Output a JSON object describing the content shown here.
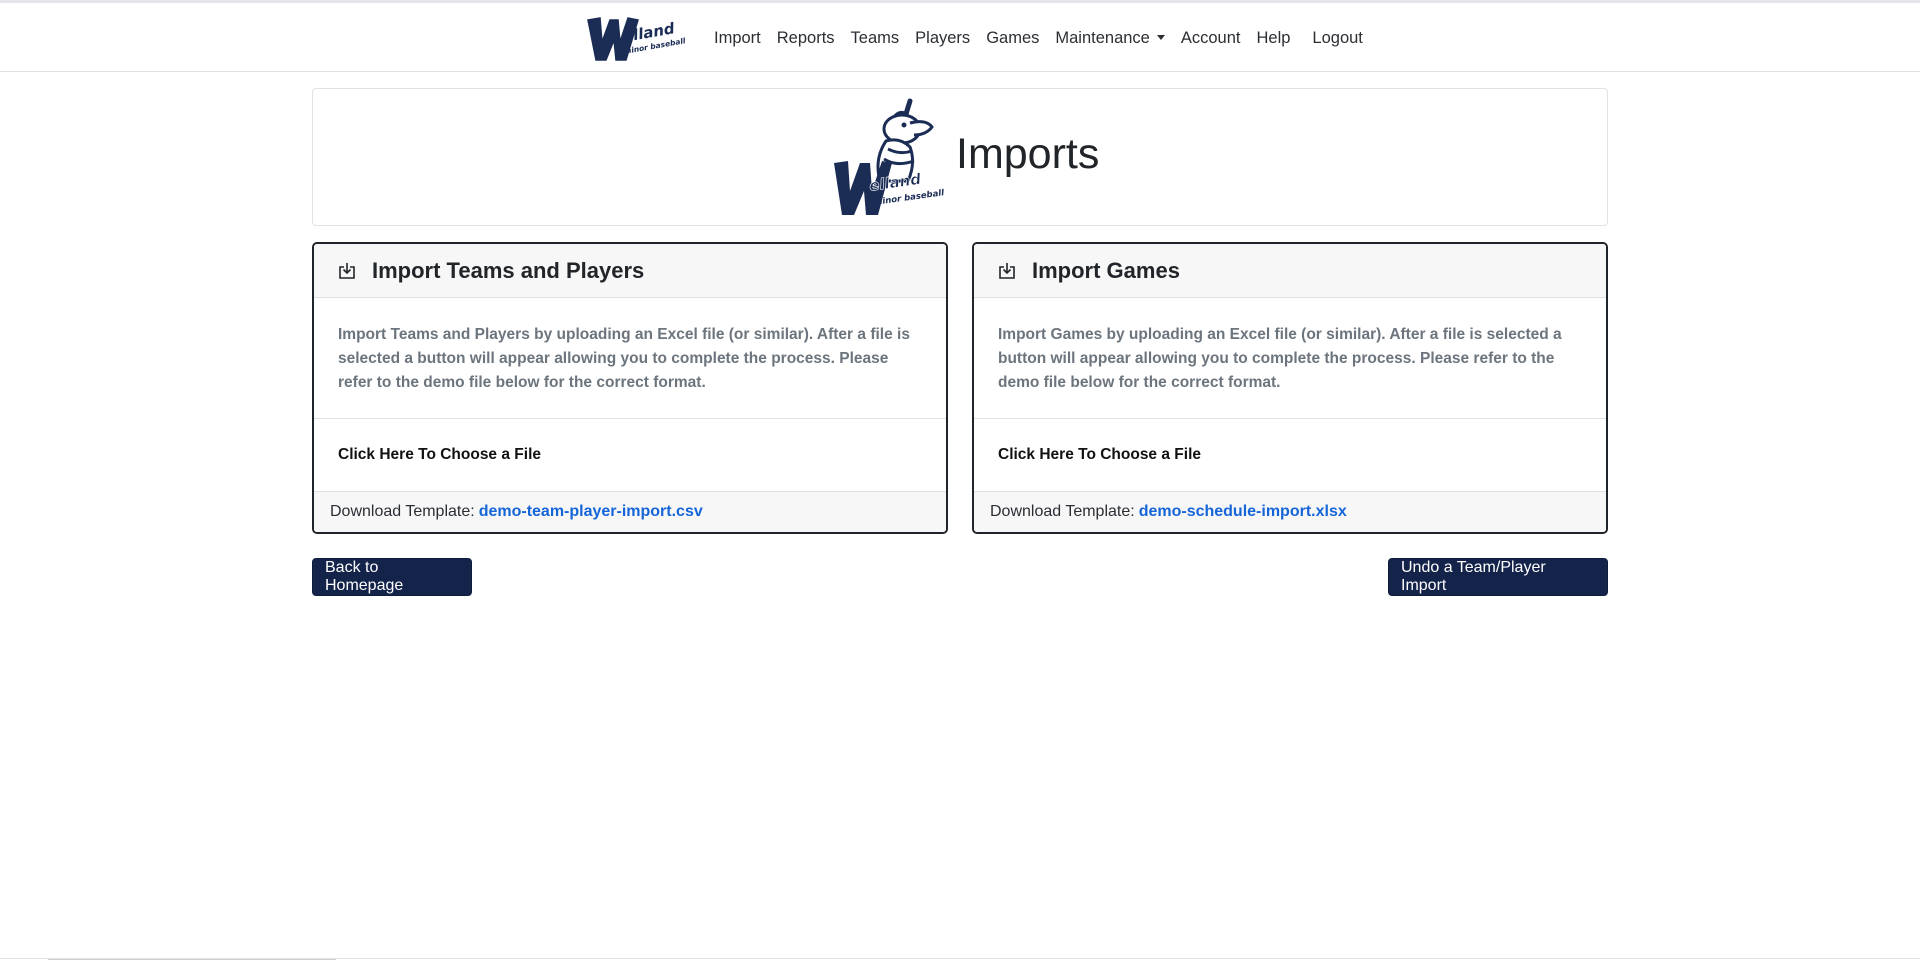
{
  "navbar": {
    "brand_alt": "Welland minor baseball",
    "items": [
      {
        "label": "Import"
      },
      {
        "label": "Reports"
      },
      {
        "label": "Teams"
      },
      {
        "label": "Players"
      },
      {
        "label": "Games"
      },
      {
        "label": "Maintenance",
        "has_dropdown": true
      },
      {
        "label": "Account"
      },
      {
        "label": "Help"
      },
      {
        "label": "Logout"
      }
    ]
  },
  "header": {
    "title": "Imports",
    "logo_alt": "Welland minor baseball mascot"
  },
  "cards": [
    {
      "title": "Import Teams and Players",
      "icon": "download-icon",
      "description": "Import Teams and Players by uploading an Excel file (or similar). After a file is selected a button will appear allowing you to complete the process. Please refer to the demo file below for the correct format.",
      "choose_label": "Click Here To Choose a File",
      "template_label": "Download Template:",
      "template_file": "demo-team-player-import.csv"
    },
    {
      "title": "Import Games",
      "icon": "download-icon",
      "description": "Import Games by uploading an Excel file (or similar). After a file is selected a button will appear allowing you to complete the process. Please refer to the demo file below for the correct format.",
      "choose_label": "Click Here To Choose a File",
      "template_label": "Download Template:",
      "template_file": "demo-schedule-import.xlsx"
    }
  ],
  "actions": {
    "back_label": "Back to Homepage",
    "undo_label": "Undo a Team/Player Import"
  },
  "colors": {
    "primary_button": "#14234a",
    "link": "#1565d8",
    "brand_navy": "#1b2c55"
  }
}
